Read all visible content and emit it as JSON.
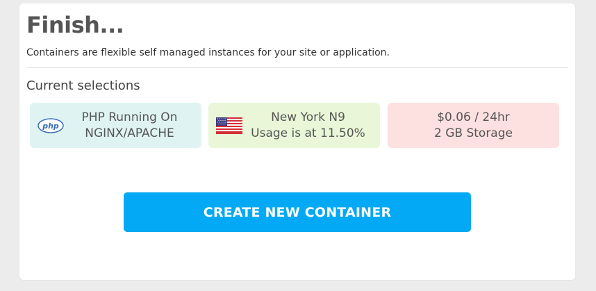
{
  "heading": {
    "title": "Finish...",
    "subtitle": "Containers are flexible self managed instances for your site or application."
  },
  "selections": {
    "heading": "Current selections",
    "stack": {
      "icon": "php-logo-icon",
      "line1": "PHP Running On",
      "line2": "NGINX/APACHE"
    },
    "location": {
      "icon": "us-flag-icon",
      "line1": "New York N9",
      "line2": "Usage is at 11.50%"
    },
    "plan": {
      "line1": "$0.06 / 24hr",
      "line2": "2 GB Storage"
    }
  },
  "actions": {
    "create_label": "CREATE NEW CONTAINER"
  },
  "colors": {
    "primary": "#03a9f4",
    "php_tile": "#e0f3f3",
    "location_tile": "#e9f7d8",
    "plan_tile": "#fde0e0"
  }
}
